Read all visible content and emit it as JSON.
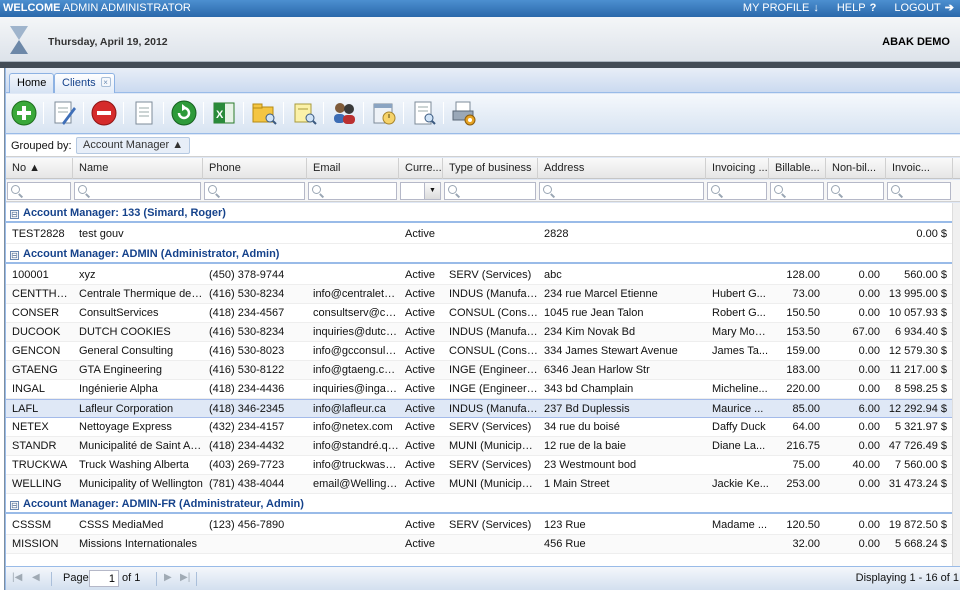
{
  "topbar": {
    "welcome_bold": "WELCOME",
    "welcome_name": "ADMIN ADMINISTRATOR",
    "my_profile": "MY PROFILE",
    "my_profile_icon": "↓",
    "help": "HELP",
    "help_icon": "?",
    "logout": "LOGOUT",
    "logout_icon": "➔"
  },
  "header": {
    "date": "Thursday, April 19, 2012",
    "company": "ABAK DEMO"
  },
  "tabs": [
    {
      "label": "Home"
    },
    {
      "label": "Clients",
      "close": "×"
    }
  ],
  "toolbar_icons": [
    "add-icon",
    "edit-icon",
    "delete-icon",
    "document-icon",
    "refresh-icon",
    "excel-export-icon",
    "folder-search-icon",
    "note-search-icon",
    "users-icon",
    "schedule-icon",
    "report-search-icon",
    "print-settings-icon"
  ],
  "groupbar": {
    "label": "Grouped by:",
    "group": "Account Manager",
    "arrow": "▲"
  },
  "columns": [
    "No ▲",
    "Name",
    "Phone",
    "Email",
    "Curre...",
    "Type of business",
    "Address",
    "Invoicing ...",
    "Billable...",
    "Non-bil...",
    "Invoic..."
  ],
  "pager": {
    "page_label": "Page",
    "page_value": "1",
    "of_label": "of 1",
    "display": "Displaying 1 - 16 of 1",
    "first": "|◀",
    "prev": "◀",
    "next": "▶",
    "last": "▶|"
  },
  "groups": [
    {
      "title": "Account Manager: 133 (Simard, Roger)",
      "expander": "⊟",
      "rows": [
        [
          "TEST2828",
          "test gouv",
          "",
          "",
          "Active",
          "",
          "2828",
          "",
          "",
          "",
          "0.00 $"
        ]
      ]
    },
    {
      "title": "Account Manager: ADMIN (Administrator, Admin)",
      "expander": "⊟",
      "rows": [
        [
          "100001",
          "xyz",
          "(450) 378-9744",
          "",
          "Active",
          "SERV (Services)",
          "abc",
          "",
          "128.00",
          "0.00",
          "560.00 $"
        ],
        [
          "CENTTHE...",
          "Centrale Thermique de B...",
          "(416) 530-8234",
          "info@centralethe...",
          "Active",
          "INDUS (Manufact...",
          "234 rue Marcel Etienne",
          "Hubert G...",
          "73.00",
          "0.00",
          "13 995.00 $"
        ],
        [
          "CONSER",
          "ConsultServices",
          "(418) 234-4567",
          "consultserv@co...",
          "Active",
          "CONSUL (Consul...",
          "1045 rue Jean Talon",
          "Robert G...",
          "150.50",
          "0.00",
          "10 057.93 $"
        ],
        [
          "DUCOOK",
          "DUTCH COOKIES",
          "(416) 530-8234",
          "inquiries@dutch...",
          "Active",
          "INDUS (Manufact...",
          "234 Kim Novak Bd",
          "Mary Morris",
          "153.50",
          "67.00",
          "6 934.40 $"
        ],
        [
          "GENCON",
          "General Consulting",
          "(416) 530-8023",
          "info@gcconsulti...",
          "Active",
          "CONSUL (Consul...",
          "334 James Stewart Avenue",
          "James Ta...",
          "159.00",
          "0.00",
          "12 579.30 $"
        ],
        [
          "GTAENG",
          "GTA Engineering",
          "(416) 530-8122",
          "info@gtaeng.com",
          "Active",
          "INGE (Engineerin...",
          "6346 Jean Harlow Str",
          "",
          "183.00",
          "0.00",
          "11 217.00 $"
        ],
        [
          "INGAL",
          "Ingénierie Alpha",
          "(418) 234-4436",
          "inquiries@ingalp...",
          "Active",
          "INGE (Engineerin...",
          "343 bd Champlain",
          "Micheline...",
          "220.00",
          "0.00",
          "8 598.25 $"
        ],
        [
          "LAFL",
          "Lafleur Corporation",
          "(418) 346-2345",
          "info@lafleur.ca",
          "Active",
          "INDUS (Manufact...",
          "237 Bd Duplessis",
          "Maurice ...",
          "85.00",
          "6.00",
          "12 292.94 $"
        ],
        [
          "NETEX",
          "Nettoyage Express",
          "(432) 234-4157",
          "info@netex.com",
          "Active",
          "SERV (Services)",
          "34 rue du boisé",
          "Daffy Duck",
          "64.00",
          "0.00",
          "5 321.97 $"
        ],
        [
          "STANDR",
          "Municipalité de Saint André",
          "(418) 234-4432",
          "info@standré.qc...",
          "Active",
          "MUNI (Municipality)",
          "12 rue de la baie",
          "Diane La...",
          "216.75",
          "0.00",
          "47 726.49 $"
        ],
        [
          "TRUCKWA",
          "Truck Washing Alberta",
          "(403) 269-7723",
          "info@truckwashi...",
          "Active",
          "SERV (Services)",
          "23 Westmount bod",
          "",
          "75.00",
          "40.00",
          "7 560.00 $"
        ],
        [
          "WELLING",
          "Municipality of Wellington",
          "(781) 438-4044",
          "email@Wellingto...",
          "Active",
          "MUNI (Municipality)",
          "1 Main Street",
          "Jackie Ke...",
          "253.00",
          "0.00",
          "31 473.24 $"
        ]
      ]
    },
    {
      "title": "Account Manager: ADMIN-FR (Administrateur, Admin)",
      "expander": "⊟",
      "rows": [
        [
          "CSSSM",
          "CSSS MediaMed",
          "(123) 456-7890",
          "",
          "Active",
          "SERV (Services)",
          "123 Rue",
          "Madame ...",
          "120.50",
          "0.00",
          "19 872.50 $"
        ],
        [
          "MISSION",
          "Missions Internationales",
          "",
          "",
          "Active",
          "",
          "456 Rue",
          "",
          "32.00",
          "0.00",
          "5 668.24 $"
        ]
      ]
    }
  ]
}
